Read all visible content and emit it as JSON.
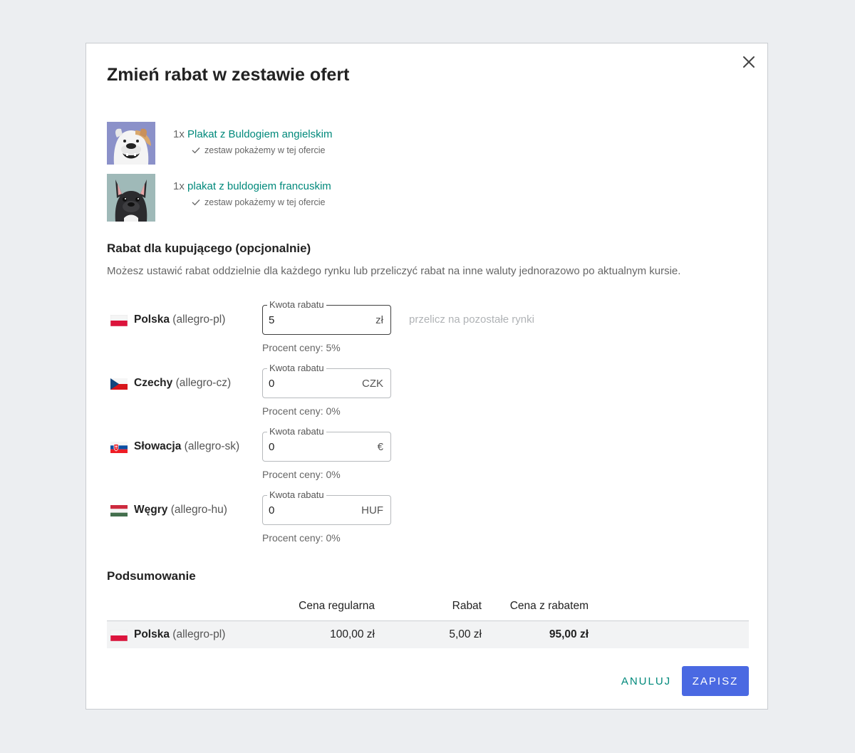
{
  "dialog": {
    "title": "Zmień rabat w zestawie ofert",
    "close_icon": "close-icon"
  },
  "offers": [
    {
      "qty": "1x",
      "name": "Plakat z Buldogiem angielskim",
      "note": "zestaw pokażemy w tej ofercie",
      "image": "english-bulldog-image"
    },
    {
      "qty": "1x",
      "name": "plakat z buldogiem francuskim",
      "note": "zestaw pokażemy w tej ofercie",
      "image": "french-bulldog-image"
    }
  ],
  "discount": {
    "title": "Rabat dla kupującego (opcjonalnie)",
    "description": "Możesz ustawić rabat oddzielnie dla każdego rynku lub przeliczyć rabat na inne waluty jednorazowo po aktualnym kursie.",
    "recalc_link": "przelicz na pozostałe rynki",
    "markets": [
      {
        "name": "Polska",
        "code": "(allegro-pl)",
        "field_label": "Kwota rabatu",
        "value": "5",
        "currency": "zł",
        "percent": "Procent ceny: 5%"
      },
      {
        "name": "Czechy",
        "code": "(allegro-cz)",
        "field_label": "Kwota rabatu",
        "value": "0",
        "currency": "CZK",
        "percent": "Procent ceny: 0%"
      },
      {
        "name": "Słowacja",
        "code": "(allegro-sk)",
        "field_label": "Kwota rabatu",
        "value": "0",
        "currency": "€",
        "percent": "Procent ceny: 0%"
      },
      {
        "name": "Węgry",
        "code": "(allegro-hu)",
        "field_label": "Kwota rabatu",
        "value": "0",
        "currency": "HUF",
        "percent": "Procent ceny: 0%"
      }
    ]
  },
  "summary": {
    "title": "Podsumowanie",
    "headers": {
      "regular": "Cena regularna",
      "discount": "Rabat",
      "discounted": "Cena z rabatem"
    },
    "rows": [
      {
        "name": "Polska",
        "code": "(allegro-pl)",
        "regular": "100,00 zł",
        "discount": "5,00 zł",
        "discounted": "95,00 zł"
      }
    ]
  },
  "actions": {
    "cancel": "ANULUJ",
    "save": "ZAPISZ"
  },
  "colors": {
    "link": "#00897b",
    "primary_button": "#4a69e2",
    "text": "#222222",
    "muted": "#666666"
  }
}
